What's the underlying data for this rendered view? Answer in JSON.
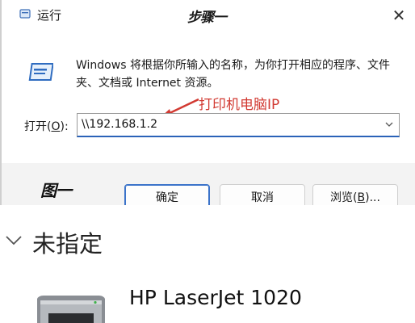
{
  "run_dialog": {
    "title": "运行",
    "step_label": "步骤一",
    "close_glyph": "✕",
    "description": "Windows 将根据你所输入的名称，为你打开相应的程序、文件夹、文档或 Internet 资源。",
    "annotation": "打印机电脑IP",
    "open_label_prefix": "打开(",
    "open_label_accel": "O",
    "open_label_suffix": "):",
    "input_value": "\\\\192.168.1.2",
    "figure_label": "图一",
    "buttons": {
      "ok": "确定",
      "cancel": "取消",
      "browse_prefix": "浏览(",
      "browse_accel": "B",
      "browse_suffix": ")..."
    },
    "accent_color": "#2a62b8",
    "annotation_color": "#d23a32"
  },
  "printer_list": {
    "section_title": "未指定",
    "printers": [
      {
        "name": "HP LaserJet 1020",
        "icon": "printer-icon"
      }
    ]
  }
}
